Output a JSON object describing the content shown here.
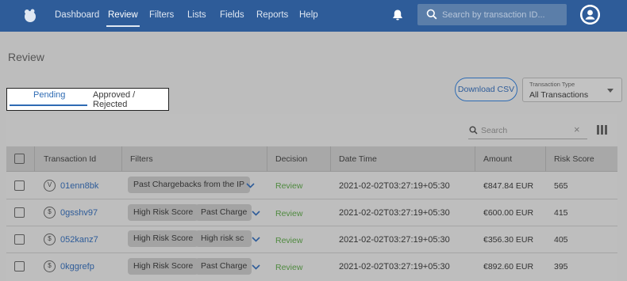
{
  "nav": {
    "items": [
      {
        "label": "Dashboard"
      },
      {
        "label": "Review"
      },
      {
        "label": "Filters"
      },
      {
        "label": "Lists"
      },
      {
        "label": "Fields"
      },
      {
        "label": "Reports"
      },
      {
        "label": "Help"
      }
    ],
    "active": "Review",
    "search_placeholder": "Search by transaction ID..."
  },
  "page": {
    "title": "Review"
  },
  "tabs": {
    "pending": "Pending",
    "approved_rejected": "Approved / Rejected",
    "active": "Pending"
  },
  "toolbar": {
    "download_label": "Download CSV",
    "transaction_type_label": "Transaction Type",
    "transaction_type_value": "All Transactions",
    "search_placeholder": "Search",
    "clear_symbol": "×"
  },
  "table": {
    "headers": [
      "Transaction Id",
      "Filters",
      "Decision",
      "Date Time",
      "Amount",
      "Risk Score"
    ],
    "rows": [
      {
        "type_icon": "V",
        "id": "01enn8bk",
        "filters": [
          "Past Chargebacks from the IP"
        ],
        "decision": "Review",
        "datetime": "2021-02-02T03:27:19+05:30",
        "amount": "€847.84 EUR",
        "risk": "565"
      },
      {
        "type_icon": "$",
        "id": "0gsshv97",
        "filters": [
          "High Risk Score",
          "Past Charge"
        ],
        "decision": "Review",
        "datetime": "2021-02-02T03:27:19+05:30",
        "amount": "€600.00 EUR",
        "risk": "415"
      },
      {
        "type_icon": "$",
        "id": "052kanz7",
        "filters": [
          "High Risk Score",
          "High risk sc"
        ],
        "decision": "Review",
        "datetime": "2021-02-02T03:27:19+05:30",
        "amount": "€356.30 EUR",
        "risk": "405"
      },
      {
        "type_icon": "$",
        "id": "0kggrefp",
        "filters": [
          "High Risk Score",
          "Past Charge"
        ],
        "decision": "Review",
        "datetime": "2021-02-02T03:27:19+05:30",
        "amount": "€892.60 EUR",
        "risk": "395"
      }
    ]
  },
  "colors": {
    "nav_bg": "#2e5c99",
    "accent": "#2e6bb3",
    "decision_review": "#4f8a3f"
  }
}
